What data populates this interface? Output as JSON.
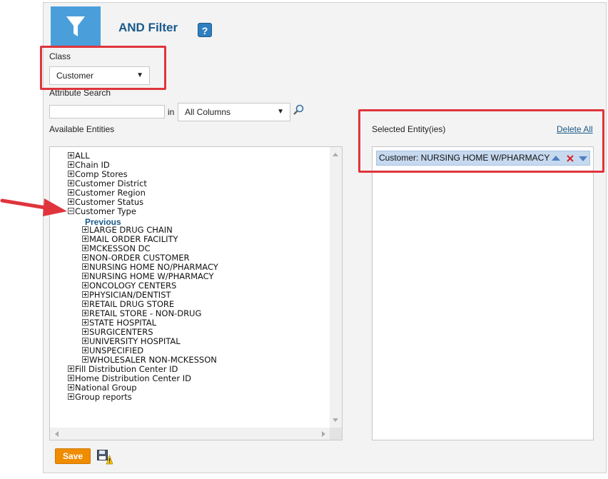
{
  "header": {
    "title": "AND Filter",
    "help_glyph": "?"
  },
  "class_field": {
    "label": "Class",
    "value": "Customer"
  },
  "attribute_search": {
    "label": "Attribute Search",
    "value": "",
    "in_label": "in",
    "scope_value": "All Columns"
  },
  "available": {
    "label": "Available Entities",
    "previous_label": "Previous",
    "top_items": [
      "ALL",
      "Chain ID",
      "Comp Stores",
      "Customer District",
      "Customer Region",
      "Customer Status"
    ],
    "expanded_item": "Customer Type",
    "children": [
      "LARGE DRUG CHAIN",
      "MAIL ORDER FACILITY",
      "MCKESSON DC",
      "NON-ORDER CUSTOMER",
      "NURSING HOME NO/PHARMACY",
      "NURSING HOME W/PHARMACY",
      "ONCOLOGY CENTERS",
      "PHYSICIAN/DENTIST",
      "RETAIL DRUG STORE",
      "RETAIL STORE - NON-DRUG",
      "STATE HOSPITAL",
      "SURGICENTERS",
      "UNIVERSITY HOSPITAL",
      "UNSPECIFIED",
      "WHOLESALER NON-MCKESSON"
    ],
    "bottom_items": [
      "Fill Distribution Center ID",
      "Home Distribution Center ID",
      "National Group",
      "Group reports"
    ]
  },
  "selected": {
    "label": "Selected Entity(ies)",
    "delete_all": "Delete All",
    "items": [
      "Customer: NURSING HOME W/PHARMACY"
    ]
  },
  "footer": {
    "save_label": "Save"
  },
  "colors": {
    "accent": "#4a9fdb",
    "title": "#1a5a8a",
    "save": "#f08c00",
    "highlight": "#e0343c",
    "selected_bg": "#c6d9ef"
  },
  "icons": [
    "filter-icon",
    "help-icon",
    "dropdown-arrow-icon",
    "magnifier-icon",
    "plus-icon",
    "minus-icon",
    "move-up-icon",
    "remove-icon",
    "move-down-icon",
    "save-warning-icon",
    "arrow-pointer-icon"
  ]
}
